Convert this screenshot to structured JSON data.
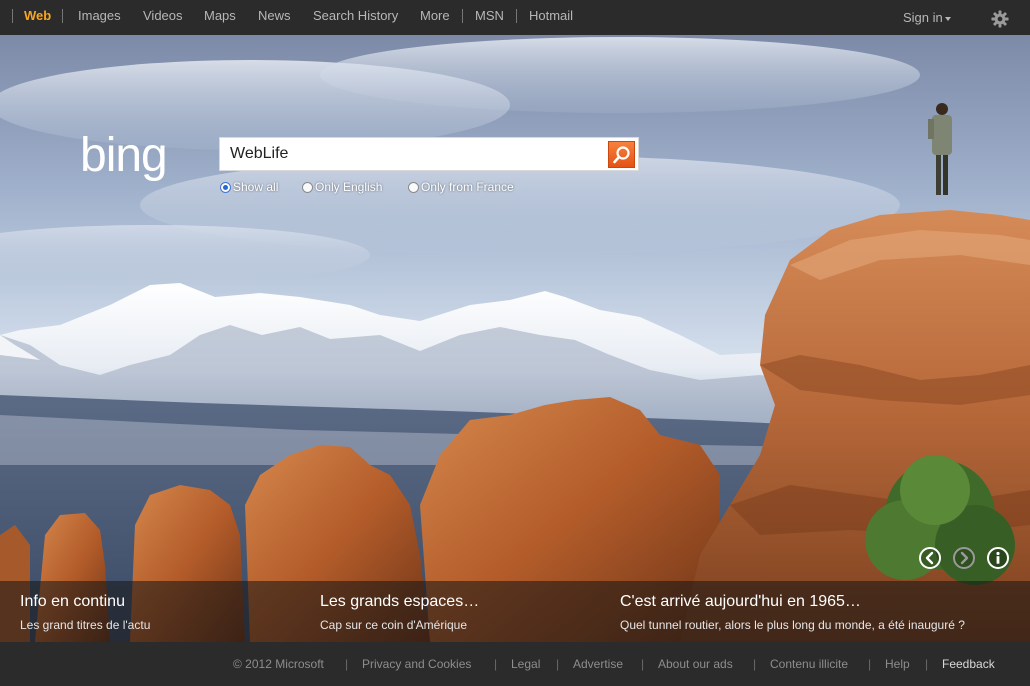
{
  "topnav": {
    "items": [
      {
        "label": "Web",
        "active": true
      },
      {
        "label": "Images"
      },
      {
        "label": "Videos"
      },
      {
        "label": "Maps"
      },
      {
        "label": "News"
      },
      {
        "label": "Search History"
      },
      {
        "label": "More"
      },
      {
        "label": "MSN"
      },
      {
        "label": "Hotmail"
      }
    ],
    "signin_label": "Sign in",
    "settings_icon": "gear-icon",
    "accent_color": "#f5a623"
  },
  "logo": {
    "text": "bing"
  },
  "search": {
    "value": "WebLife",
    "button_icon": "search-icon",
    "button_color": "#f0561e",
    "filters": [
      {
        "label": "Show all",
        "checked": true
      },
      {
        "label": "Only English",
        "checked": false
      },
      {
        "label": "Only from France",
        "checked": false
      }
    ]
  },
  "carousel": {
    "prev_icon": "chevron-left-icon",
    "next_icon": "chevron-right-icon",
    "info_icon": "info-icon"
  },
  "captions": [
    {
      "title": "Info en continu",
      "subtitle": "Les grand titres de l'actu"
    },
    {
      "title": "Les grands espaces…",
      "subtitle": "Cap sur ce coin d'Amérique"
    },
    {
      "title": "C'est arrivé aujourd'hui en 1965…",
      "subtitle": "Quel tunnel routier, alors le plus long du monde, a été inauguré ?"
    }
  ],
  "footer": {
    "copyright": "© 2012 Microsoft",
    "links": [
      "Privacy and Cookies",
      "Legal",
      "Advertise",
      "About our ads",
      "Contenu illicite",
      "Help",
      "Feedback"
    ],
    "separator": "|"
  }
}
